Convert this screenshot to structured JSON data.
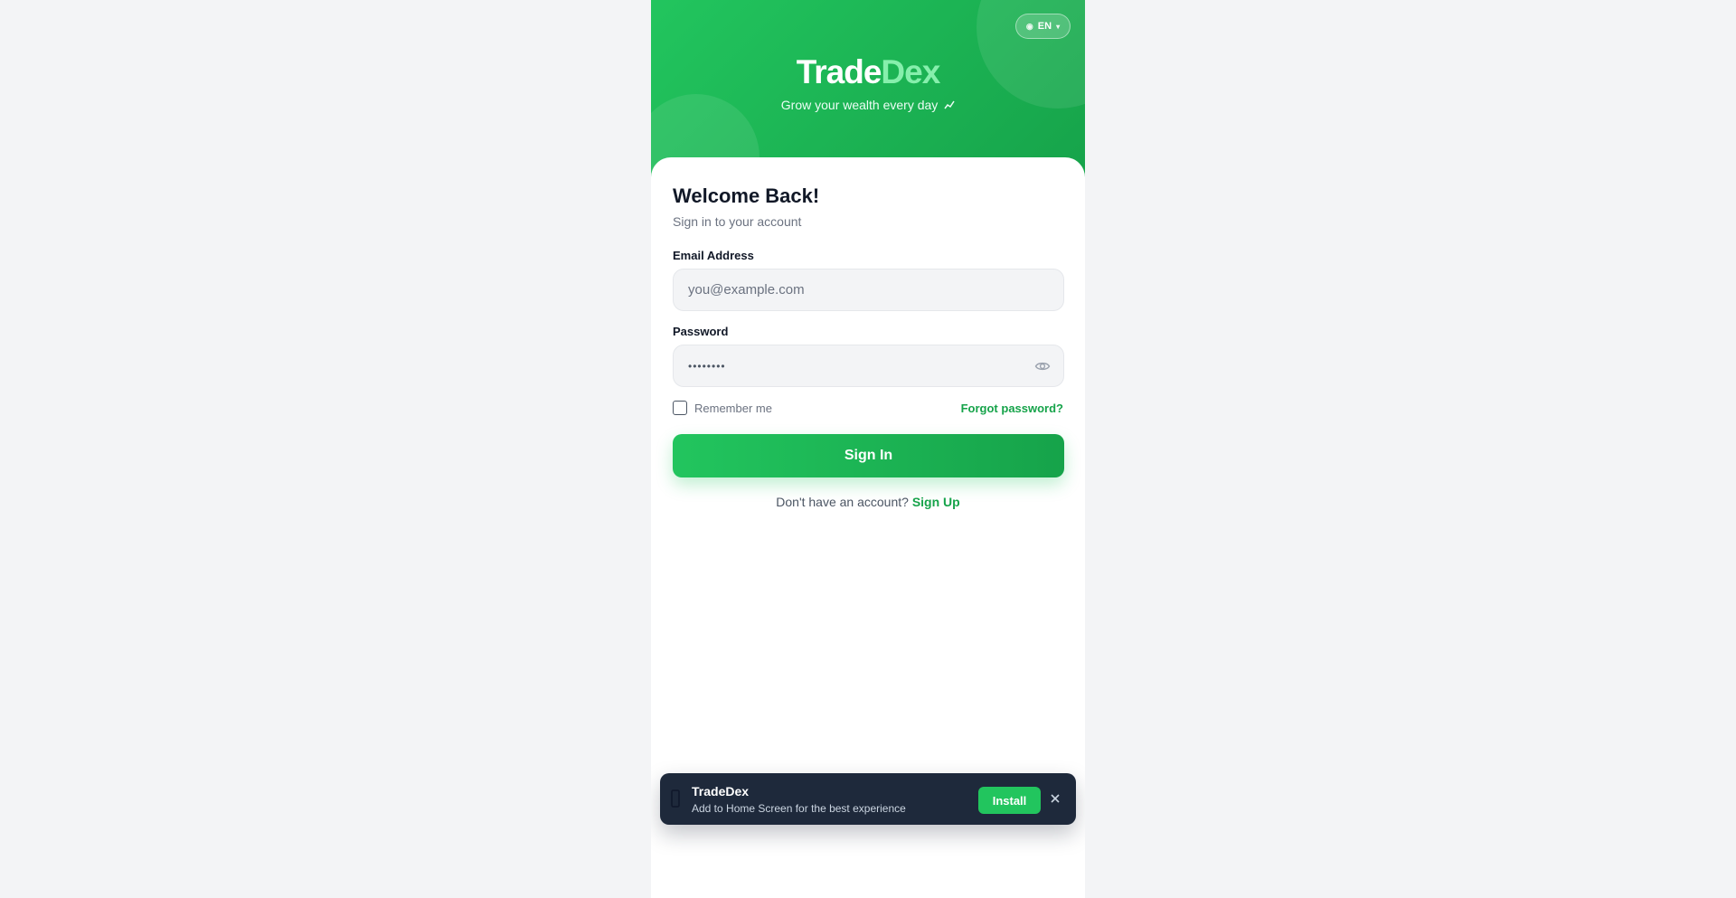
{
  "header": {
    "brand_part1": "Trade",
    "brand_part2": "Dex",
    "tagline": "Grow your wealth every day",
    "tagline_icon": "chart-up-icon",
    "language": {
      "code": "EN",
      "icons": [
        "globe-flag-icon",
        "chevron-down-icon"
      ]
    }
  },
  "login": {
    "title": "Welcome Back!",
    "subtitle": "Sign in to your account",
    "email_label": "Email Address",
    "email_placeholder": "you@example.com",
    "email_value": "",
    "password_label": "Password",
    "password_value": "••••••••",
    "password_toggle_icon": "eye-icon",
    "remember_label": "Remember me",
    "remember_checked": false,
    "forgot_label": "Forgot password?",
    "submit_label": "Sign In",
    "signup_prompt": "Don't have an account?",
    "signup_link": "Sign Up"
  },
  "install_banner": {
    "app_name": "TradeDex",
    "message": "Add to Home Screen for the best experience",
    "install_label": "Install",
    "icons": [
      "phone-icon",
      "close-icon"
    ]
  },
  "colors": {
    "brand_green": "#22c55e",
    "brand_green_dark": "#16a34a",
    "brand_accent_light": "#86efac",
    "banner_bg": "#1e293b",
    "page_bg": "#f3f4f6"
  }
}
